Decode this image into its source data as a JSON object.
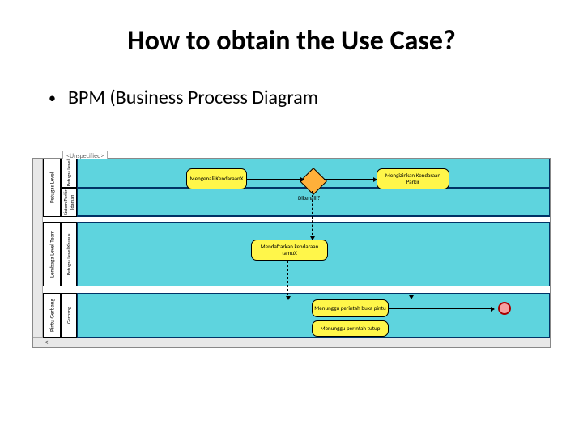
{
  "slide": {
    "title": "How to obtain the Use Case?",
    "bullet": "BPM (Business Process Diagram"
  },
  "diagram": {
    "cornerTab": "<Unspecified>",
    "pools": [
      {
        "label": "Petugas Level"
      },
      {
        "label": "Lembaga Level Team"
      },
      {
        "label": "Pintu Gerbang"
      }
    ],
    "lanes": [
      {
        "label": "Petugas Level"
      },
      {
        "label": "Sistem Parkir Idaman"
      },
      {
        "label": "Petugas Level Khusus"
      },
      {
        "label": "Gerbang"
      }
    ],
    "tasks": {
      "t1": "Mengenali KendaraanX",
      "t2": "Mengizinkan Kendaraan Parkir",
      "t3": "Mendaftarkan kendaraan tamuX",
      "t4": "Menunggu perintah buka pintu",
      "t5": "Menunggu perintah tutup"
    },
    "gateway": {
      "label": "Dikenali ?"
    }
  },
  "colors": {
    "lane": "#5ed4de",
    "task": "#fff64a",
    "gateway": "#ffb03a",
    "end": "#f5a0a0"
  }
}
